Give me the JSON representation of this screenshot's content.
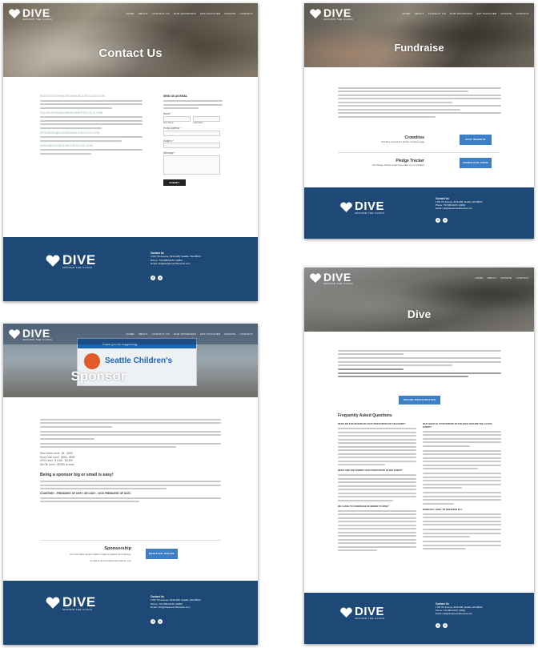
{
  "brand": {
    "name": "DIVE",
    "tagline": "AROUND THE CLOCK"
  },
  "nav": {
    "items": [
      "HOME",
      "ABOUT",
      "CONTACT US",
      "OUR SPONSORS",
      "GET INVOLVED",
      "DONATE",
      "CONTACT"
    ]
  },
  "colors": {
    "navy": "#1e4876",
    "button": "#1f4f8f",
    "link": "#2a7abf"
  },
  "footer": {
    "heading": "Contact Us",
    "address": "1700 7th Avenue, #116-268, Seattle, WA 98101",
    "phone": "Phone: 737-808-DATC (3282)",
    "email": "Email: info@divearoundtheclock.com",
    "social": [
      "facebook-icon",
      "twitter-icon"
    ]
  },
  "contact": {
    "title": "Contact Us",
    "emails": [
      "REGISTRATION@DIVEAROUNDTHECLOCK.COM",
      "VOLUNTEERS@DIVEAROUNDTHECLOCK.COM",
      "SPONSORS@DIVEAROUNDTHECLOCK.COM",
      "MEDIA@DIVEAROUNDTHECLOCK.COM"
    ],
    "form": {
      "heading": "SEND US AN EMAIL",
      "name": "Name *",
      "first": "First Name",
      "last": "Last Name",
      "email": "Email Address *",
      "subject": "Subject *",
      "message": "Message *",
      "submit": "SUBMIT"
    }
  },
  "fundraise": {
    "title": "Fundraise",
    "crowdrise": {
      "title": "Crowdrise",
      "desc": "Visit Dive Around the Clock's donation page",
      "button": "VISIT WEBSITE"
    },
    "pledge": {
      "title": "Pledge Tracker",
      "desc": "Our Pledge Tracker helps keep track of your pledges",
      "button": "DOWNLOAD FORM"
    }
  },
  "sponsor": {
    "title": "Sponsor",
    "banner_top": "Thank you for supporting",
    "banner_main": "Seattle Children's",
    "levels": [
      "Sea Urchin Level - $1 - $499",
      "Rock Crab Level - $500 - $999",
      "GPO Level - $1,000 - $3,499",
      "Six Gill Level - $3,500 or more"
    ],
    "heading": "Being a sponsor big or small is easy!",
    "contact_line": "COURTNEY - PRESIDENT OF DATC OR CODY - VICE PRESIDENT OF DATC",
    "cta_title": "Sponsorship",
    "cta_text1": "Our new online system makes it easy to register as a sponsor.",
    "cta_text2": "Or call us and we will do the work for you!",
    "cta_button": "REGISTER ONLINE"
  },
  "dive": {
    "title": "Dive",
    "button": "ONLINE REGISTRATION",
    "faq_title": "Frequently Asked Questions",
    "questions": [
      "WHAT DO THE DIVERS DO THAT PARTICIPATE IN THE EVENT?",
      "WHAT ARE THE DIVERS THAT PARTICIPATE IN THE EVENT?",
      "DO I HAVE TO FUNDRAISE IN ORDER TO DIVE?",
      "WHY SHOULD I PARTICIPATE IN THE DIVE AROUND THE CLOCK EVENT?",
      "WHEN DO I HAVE TO REGISTER BY?"
    ]
  }
}
